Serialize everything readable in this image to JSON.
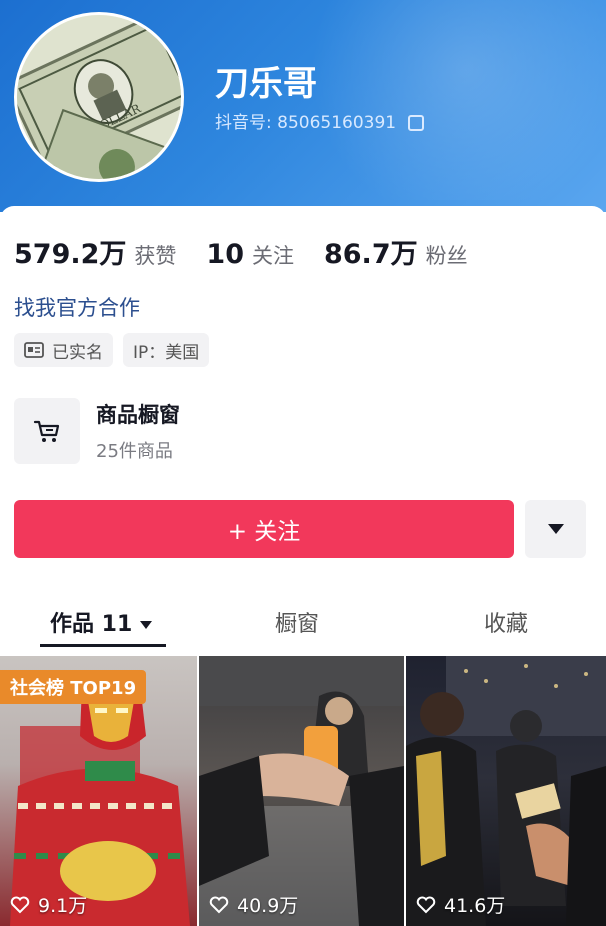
{
  "profile": {
    "name": "刀乐哥",
    "douyin_id_label": "抖音号:",
    "douyin_id": "85065160391"
  },
  "stats": [
    {
      "num": "579.2万",
      "label": "获赞"
    },
    {
      "num": "10",
      "label": "关注"
    },
    {
      "num": "86.7万",
      "label": "粉丝"
    }
  ],
  "collab_link": "找我官方合作",
  "tags": {
    "verified": "已实名",
    "ip": "IP：美国"
  },
  "shop": {
    "title": "商品橱窗",
    "subtitle": "25件商品"
  },
  "follow_button": "+ 关注",
  "tabs": {
    "works": "作品 11",
    "window": "橱窗",
    "favorites": "收藏"
  },
  "videos": [
    {
      "badge": "社会榜 TOP19",
      "likes": "9.1万"
    },
    {
      "badge": "",
      "likes": "40.9万"
    },
    {
      "badge": "",
      "likes": "41.6万"
    }
  ],
  "colors": {
    "header_blue": "#2e86de",
    "follow_red": "#f2385b",
    "badge_orange": "#e98a2a",
    "link_blue": "#2c4f8f"
  }
}
